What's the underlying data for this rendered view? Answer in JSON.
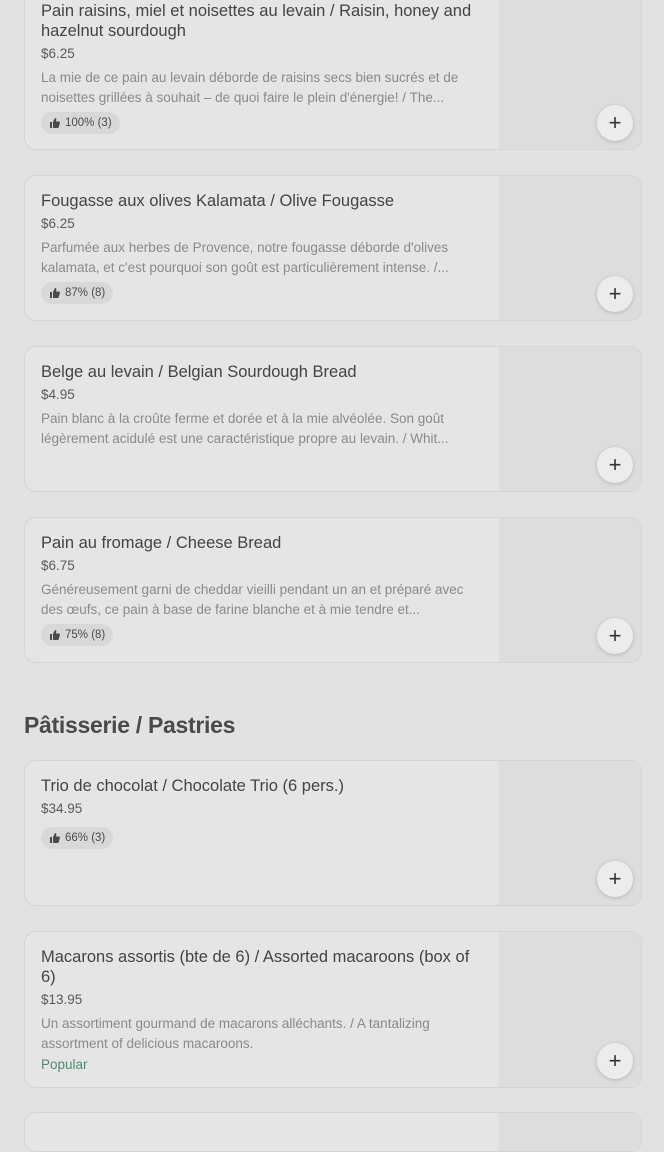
{
  "items": [
    {
      "name": "Pain raisins, miel et noisettes au levain / Raisin, honey and hazelnut sourdough",
      "price": "$6.25",
      "description": "La mie de ce pain au levain déborde de raisins secs bien sucrés et de noisettes grillées à souhait – de quoi faire le plein d'énergie! / The...",
      "rating": "100% (3)"
    },
    {
      "name": "Fougasse aux olives Kalamata / Olive Fougasse",
      "price": "$6.25",
      "description": "Parfumée aux herbes de Provence, notre fougasse déborde d'olives kalamata, et c'est pourquoi son goût est particulièrement intense. /...",
      "rating": "87% (8)"
    },
    {
      "name": "Belge au levain / Belgian Sourdough Bread",
      "price": "$4.95",
      "description": "Pain blanc à la croûte ferme et dorée et à la mie alvéolée. Son goût légèrement acidulé est une caractéristique propre au levain. / Whit..."
    },
    {
      "name": "Pain au fromage / Cheese Bread",
      "price": "$6.75",
      "description": "Généreusement garni de cheddar vieilli pendant un an et préparé avec des œufs, ce pain à base de farine blanche et à mie tendre et...",
      "rating": "75% (8)"
    }
  ],
  "pastries": {
    "title": "Pâtisserie / Pastries",
    "items": [
      {
        "name": "Trio de chocolat / Chocolate Trio (6 pers.)",
        "price": "$34.95",
        "rating": "66% (3)"
      },
      {
        "name": "Macarons assortis (bte de 6) / Assorted macaroons (box of 6)",
        "price": "$13.95",
        "description": "Un assortiment gourmand de macarons alléchants. / A tantalizing assortment of delicious macaroons.",
        "tag": "Popular"
      }
    ]
  },
  "add_button_label": "+",
  "icons": {
    "thumb": "thumbs-up-icon",
    "add": "plus-icon"
  }
}
